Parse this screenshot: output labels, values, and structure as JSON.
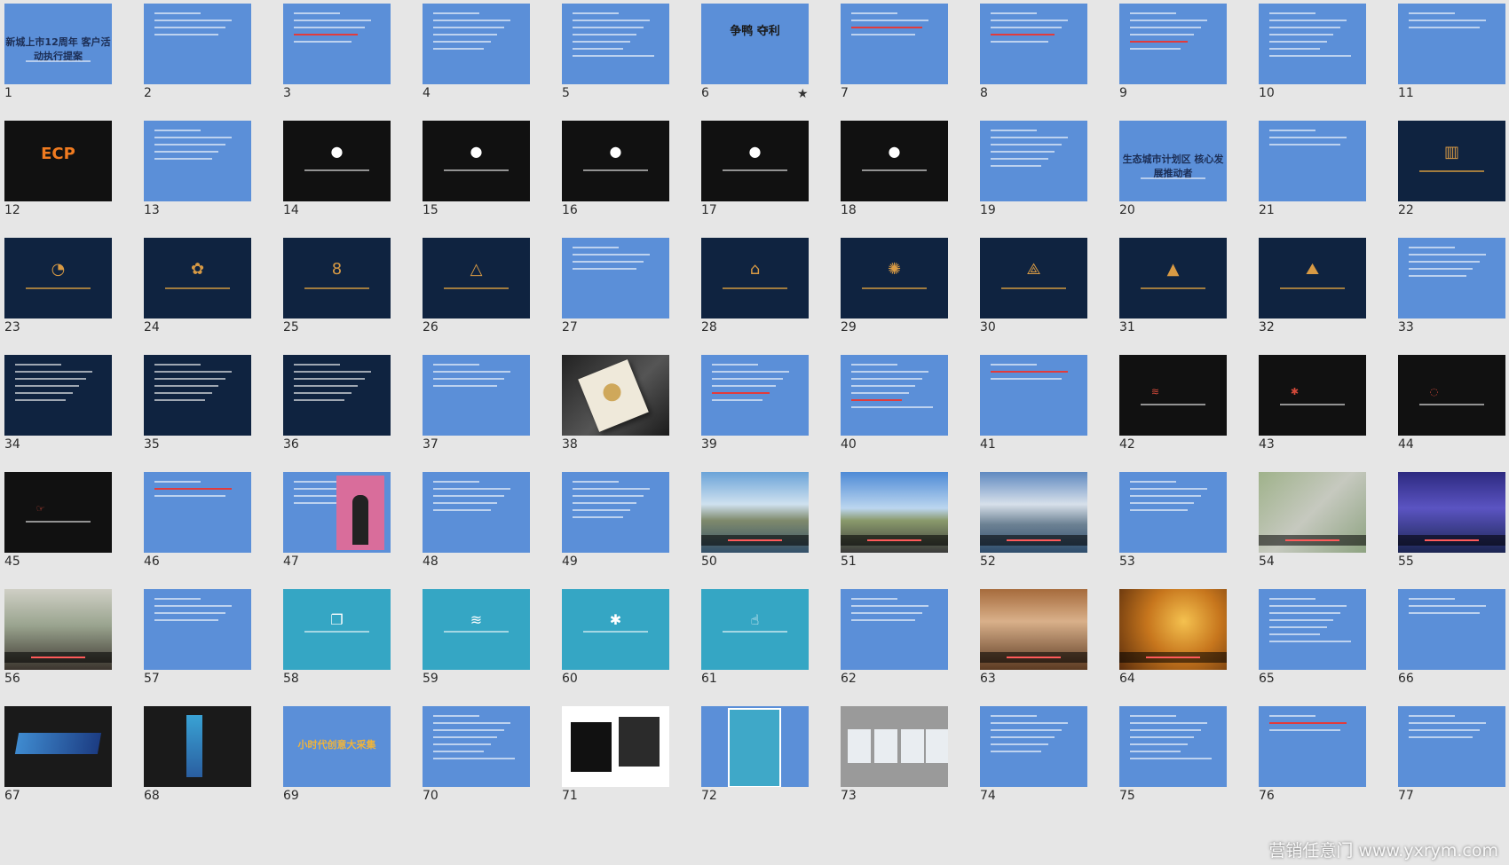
{
  "slides": [
    {
      "n": "1",
      "style": "blue",
      "title": "新城上市12周年 客户活动执行提案"
    },
    {
      "n": "2",
      "style": "blue"
    },
    {
      "n": "3",
      "style": "blue",
      "red": true
    },
    {
      "n": "4",
      "style": "blue"
    },
    {
      "n": "5",
      "style": "blue"
    },
    {
      "n": "6",
      "style": "blue",
      "title": "争鸭 夺利",
      "marked": true
    },
    {
      "n": "7",
      "style": "blue",
      "red": true
    },
    {
      "n": "8",
      "style": "blue",
      "red": true
    },
    {
      "n": "9",
      "style": "blue",
      "red": true
    },
    {
      "n": "10",
      "style": "blue"
    },
    {
      "n": "11",
      "style": "blue"
    },
    {
      "n": "12",
      "style": "black",
      "title": "ECP",
      "glyph": "ecp"
    },
    {
      "n": "13",
      "style": "blue"
    },
    {
      "n": "14",
      "style": "black",
      "glyph": "dot"
    },
    {
      "n": "15",
      "style": "black",
      "glyph": "dot"
    },
    {
      "n": "16",
      "style": "black",
      "glyph": "dot"
    },
    {
      "n": "17",
      "style": "black",
      "glyph": "dot"
    },
    {
      "n": "18",
      "style": "black",
      "glyph": "dot"
    },
    {
      "n": "19",
      "style": "blue"
    },
    {
      "n": "20",
      "style": "blue",
      "title": "生态城市计划区 核心发展推动者"
    },
    {
      "n": "21",
      "style": "blue"
    },
    {
      "n": "22",
      "style": "navy",
      "glyph": "bars"
    },
    {
      "n": "23",
      "style": "navy",
      "glyph": "drop"
    },
    {
      "n": "24",
      "style": "navy",
      "glyph": "flower"
    },
    {
      "n": "25",
      "style": "navy",
      "glyph": "eight"
    },
    {
      "n": "26",
      "style": "navy",
      "glyph": "mountain"
    },
    {
      "n": "27",
      "style": "blue"
    },
    {
      "n": "28",
      "style": "navy",
      "glyph": "dome"
    },
    {
      "n": "29",
      "style": "navy",
      "glyph": "sun"
    },
    {
      "n": "30",
      "style": "navy",
      "glyph": "tri"
    },
    {
      "n": "31",
      "style": "navy",
      "glyph": "cap"
    },
    {
      "n": "32",
      "style": "navy",
      "glyph": "peak"
    },
    {
      "n": "33",
      "style": "blue"
    },
    {
      "n": "34",
      "style": "navy-text"
    },
    {
      "n": "35",
      "style": "navy-text"
    },
    {
      "n": "36",
      "style": "navy-text"
    },
    {
      "n": "37",
      "style": "blue"
    },
    {
      "n": "38",
      "style": "book"
    },
    {
      "n": "39",
      "style": "blue",
      "red": true
    },
    {
      "n": "40",
      "style": "blue",
      "red": true
    },
    {
      "n": "41",
      "style": "blue",
      "red": true
    },
    {
      "n": "42",
      "style": "black",
      "glyph": "wifi"
    },
    {
      "n": "43",
      "style": "black",
      "glyph": "bt"
    },
    {
      "n": "44",
      "style": "black",
      "glyph": "ring"
    },
    {
      "n": "45",
      "style": "black",
      "glyph": "hand"
    },
    {
      "n": "46",
      "style": "blue",
      "red": true
    },
    {
      "n": "47",
      "style": "person"
    },
    {
      "n": "48",
      "style": "blue"
    },
    {
      "n": "49",
      "style": "blue"
    },
    {
      "n": "50",
      "style": "photo",
      "ph": "city"
    },
    {
      "n": "51",
      "style": "photo",
      "ph": "road"
    },
    {
      "n": "52",
      "style": "photo",
      "ph": "lake"
    },
    {
      "n": "53",
      "style": "blue"
    },
    {
      "n": "54",
      "style": "photo",
      "ph": "map"
    },
    {
      "n": "55",
      "style": "photo",
      "ph": "night"
    },
    {
      "n": "56",
      "style": "photo",
      "ph": "class"
    },
    {
      "n": "57",
      "style": "blue"
    },
    {
      "n": "58",
      "style": "teal",
      "glyph": "copy"
    },
    {
      "n": "59",
      "style": "teal",
      "glyph": "wifi"
    },
    {
      "n": "60",
      "style": "teal",
      "glyph": "bt"
    },
    {
      "n": "61",
      "style": "teal",
      "glyph": "thumb"
    },
    {
      "n": "62",
      "style": "blue"
    },
    {
      "n": "63",
      "style": "photo",
      "ph": "meet"
    },
    {
      "n": "64",
      "style": "photo",
      "ph": "gold"
    },
    {
      "n": "65",
      "style": "blue"
    },
    {
      "n": "66",
      "style": "blue"
    },
    {
      "n": "67",
      "style": "logo-band"
    },
    {
      "n": "68",
      "style": "logo-vert"
    },
    {
      "n": "69",
      "style": "blue",
      "title": "小时代创意大采集"
    },
    {
      "n": "70",
      "style": "blue"
    },
    {
      "n": "71",
      "style": "bags"
    },
    {
      "n": "72",
      "style": "poster"
    },
    {
      "n": "73",
      "style": "posters-row"
    },
    {
      "n": "74",
      "style": "blue"
    },
    {
      "n": "75",
      "style": "blue"
    },
    {
      "n": "76",
      "style": "blue",
      "red": true
    },
    {
      "n": "77",
      "style": "blue"
    }
  ],
  "star": "★",
  "watermark": "营销任意门 www.yxrym.com",
  "colors": {
    "blue": "#5b8fd8",
    "black": "#111111",
    "navy": "#0f2340",
    "teal": "#35a6c4",
    "background": "#e6e6e6"
  }
}
